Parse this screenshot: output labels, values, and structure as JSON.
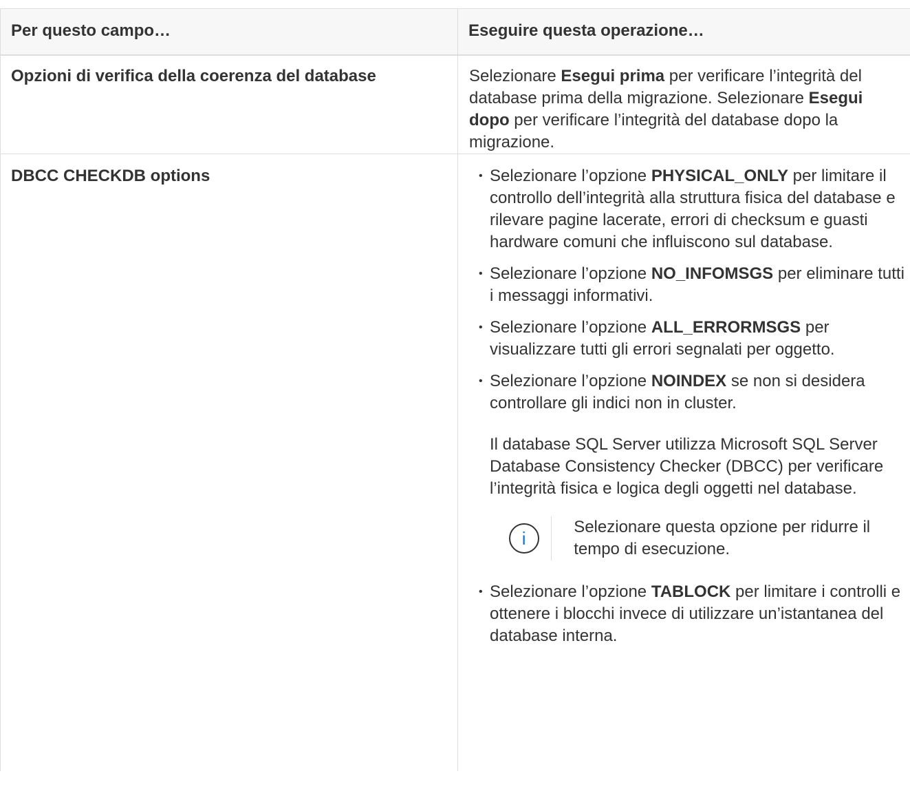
{
  "header": {
    "col1": "Per questo campo…",
    "col2": "Eseguire questa operazione…"
  },
  "rows": [
    {
      "label": "Opzioni di verifica della coerenza del database",
      "desc": {
        "t1": "Selezionare ",
        "b1": "Esegui prima",
        "t2": " per verificare l’integrità del database prima della migrazione. Selezionare ",
        "b2": "Esegui dopo",
        "t3": " per verificare l’integrità del database dopo la migrazione."
      }
    },
    {
      "label": "DBCC CHECKDB options",
      "items": [
        {
          "pre": "Selezionare l’opzione ",
          "bold": "PHYSICAL_ONLY",
          "post": " per limitare il controllo dell’integrità alla struttura fisica del database e rilevare pagine lacerate, errori di checksum e guasti hardware comuni che influiscono sul database."
        },
        {
          "pre": "Selezionare l’opzione ",
          "bold": "NO_INFOMSGS",
          "post": " per eliminare tutti i messaggi informativi."
        },
        {
          "pre": "Selezionare l’opzione ",
          "bold": "ALL_ERRORMSGS",
          "post": " per visualizzare tutti gli errori segnalati per oggetto."
        },
        {
          "pre": "Selezionare l’opzione ",
          "bold": "NOINDEX",
          "post": " se non si desidera controllare gli indici non in cluster.",
          "extra": "Il database SQL Server utilizza Microsoft SQL Server Database Consistency Checker (DBCC) per verificare l’integrità fisica e logica degli oggetti nel database."
        },
        {
          "pre": "Selezionare l’opzione ",
          "bold": "TABLOCK",
          "post": " per limitare i controlli e ottenere i blocchi invece di utilizzare un’istantanea del database interna."
        }
      ],
      "note": {
        "icon": "info-icon",
        "icon_glyph": "i",
        "text": "Selezionare questa opzione per ridurre il tempo di esecuzione."
      }
    }
  ],
  "bullet_glyph": "•"
}
